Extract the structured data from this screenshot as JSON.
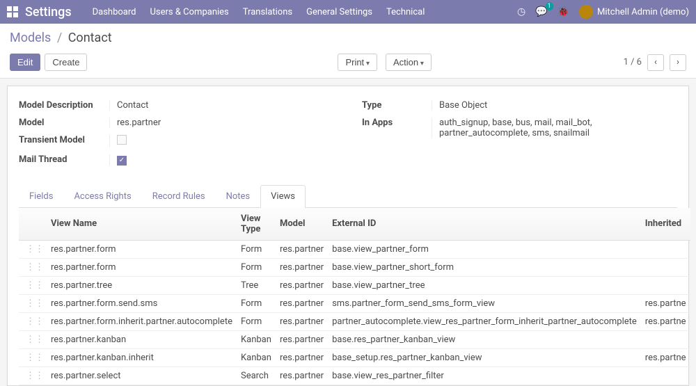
{
  "navbar": {
    "brand": "Settings",
    "menu": [
      "Dashboard",
      "Users & Companies",
      "Translations",
      "General Settings",
      "Technical"
    ],
    "messages_count": "1",
    "user": "Mitchell Admin (demo)"
  },
  "breadcrumb": {
    "root": "Models",
    "current": "Contact"
  },
  "toolbar": {
    "edit": "Edit",
    "create": "Create",
    "print": "Print",
    "action": "Action",
    "pager": "1 / 6"
  },
  "form": {
    "left": [
      {
        "label": "Model Description",
        "val": "Contact"
      },
      {
        "label": "Model",
        "val": "res.partner"
      },
      {
        "label": "Transient Model",
        "kind": "checkbox",
        "checked": false
      },
      {
        "label": "Mail Thread",
        "kind": "checkbox",
        "checked": true
      }
    ],
    "right": [
      {
        "label": "Type",
        "val": "Base Object"
      },
      {
        "label": "In Apps",
        "val": "auth_signup, base, bus, mail, mail_bot, partner_autocomplete, sms, snailmail"
      }
    ]
  },
  "tabs": [
    "Fields",
    "Access Rights",
    "Record Rules",
    "Notes",
    "Views"
  ],
  "active_tab": "Views",
  "table": {
    "cols": [
      "View Name",
      "View Type",
      "Model",
      "External ID",
      "Inherited"
    ],
    "rows": [
      {
        "name": "res.partner.form",
        "type": "Form",
        "model": "res.partner",
        "extid": "base.view_partner_form",
        "inh": ""
      },
      {
        "name": "res.partner.form",
        "type": "Form",
        "model": "res.partner",
        "extid": "base.view_partner_short_form",
        "inh": ""
      },
      {
        "name": "res.partner.tree",
        "type": "Tree",
        "model": "res.partner",
        "extid": "base.view_partner_tree",
        "inh": ""
      },
      {
        "name": "res.partner.form.send.sms",
        "type": "Form",
        "model": "res.partner",
        "extid": "sms.partner_form_send_sms_form_view",
        "inh": "res.partne"
      },
      {
        "name": "res.partner.form.inherit.partner.autocomplete",
        "type": "Form",
        "model": "res.partner",
        "extid": "partner_autocomplete.view_res_partner_form_inherit_partner_autocomplete",
        "inh": "res.partne"
      },
      {
        "name": "res.partner.kanban",
        "type": "Kanban",
        "model": "res.partner",
        "extid": "base.res_partner_kanban_view",
        "inh": ""
      },
      {
        "name": "res.partner.kanban.inherit",
        "type": "Kanban",
        "model": "res.partner",
        "extid": "base_setup.res_partner_kanban_view",
        "inh": "res.partne"
      },
      {
        "name": "res.partner.select",
        "type": "Search",
        "model": "res.partner",
        "extid": "base.view_res_partner_filter",
        "inh": ""
      }
    ]
  }
}
